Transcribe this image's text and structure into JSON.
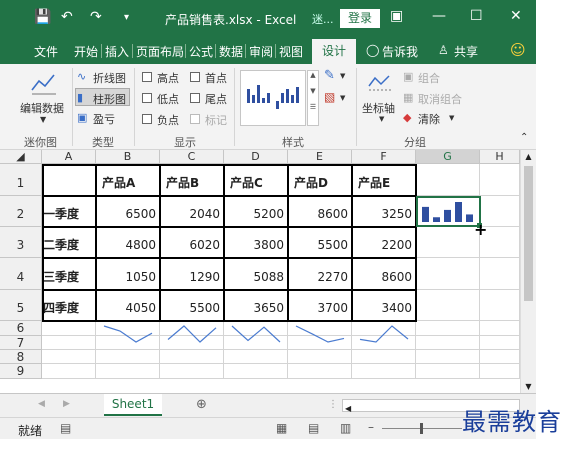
{
  "titlebar": {
    "save_icon": "save-icon",
    "undo_icon": "undo-icon",
    "redo_icon": "redo-icon",
    "customize_icon": "customize-qat-icon",
    "title": "产品销售表.xlsx - Excel",
    "context_label": "迷...",
    "login_label": "登录"
  },
  "tabs": [
    "文件",
    "开始",
    "插入",
    "页面布局",
    "公式",
    "数据",
    "审阅",
    "视图",
    "设计"
  ],
  "active_tab": "设计",
  "tell_me": "告诉我",
  "share": "共享",
  "ribbon": {
    "edit_data": "编辑数据",
    "types": [
      "折线图",
      "柱形图",
      "盈亏"
    ],
    "show": {
      "high_point": "高点",
      "first_point": "首点",
      "low_point": "低点",
      "last_point": "尾点",
      "negative_point": "负点",
      "markers": "标记"
    },
    "axis": "坐标轴",
    "group": "组合",
    "ungroup": "取消组合",
    "clear": "清除",
    "group_labels": [
      "迷你图",
      "类型",
      "显示",
      "样式",
      "分组"
    ]
  },
  "sheet": {
    "columns": [
      "A",
      "B",
      "C",
      "D",
      "E",
      "F",
      "G",
      "H"
    ],
    "rows": [
      "1",
      "2",
      "3",
      "4",
      "5",
      "6",
      "7",
      "8",
      "9"
    ],
    "header_row": [
      "",
      "产品A",
      "产品B",
      "产品C",
      "产品D",
      "产品E"
    ],
    "data": [
      {
        "label": "一季度",
        "values": [
          6500,
          2040,
          5200,
          8600,
          3250
        ]
      },
      {
        "label": "二季度",
        "values": [
          4800,
          6020,
          3800,
          5500,
          2200
        ]
      },
      {
        "label": "三季度",
        "values": [
          1050,
          1290,
          5088,
          2270,
          8600
        ]
      },
      {
        "label": "四季度",
        "values": [
          4050,
          5500,
          3650,
          3700,
          3400
        ]
      }
    ],
    "sparkline_color": "#2f4fa0",
    "selected_cell": "G2"
  },
  "sheet_tab": "Sheet1",
  "status": "就绪",
  "watermark": "最需教育"
}
